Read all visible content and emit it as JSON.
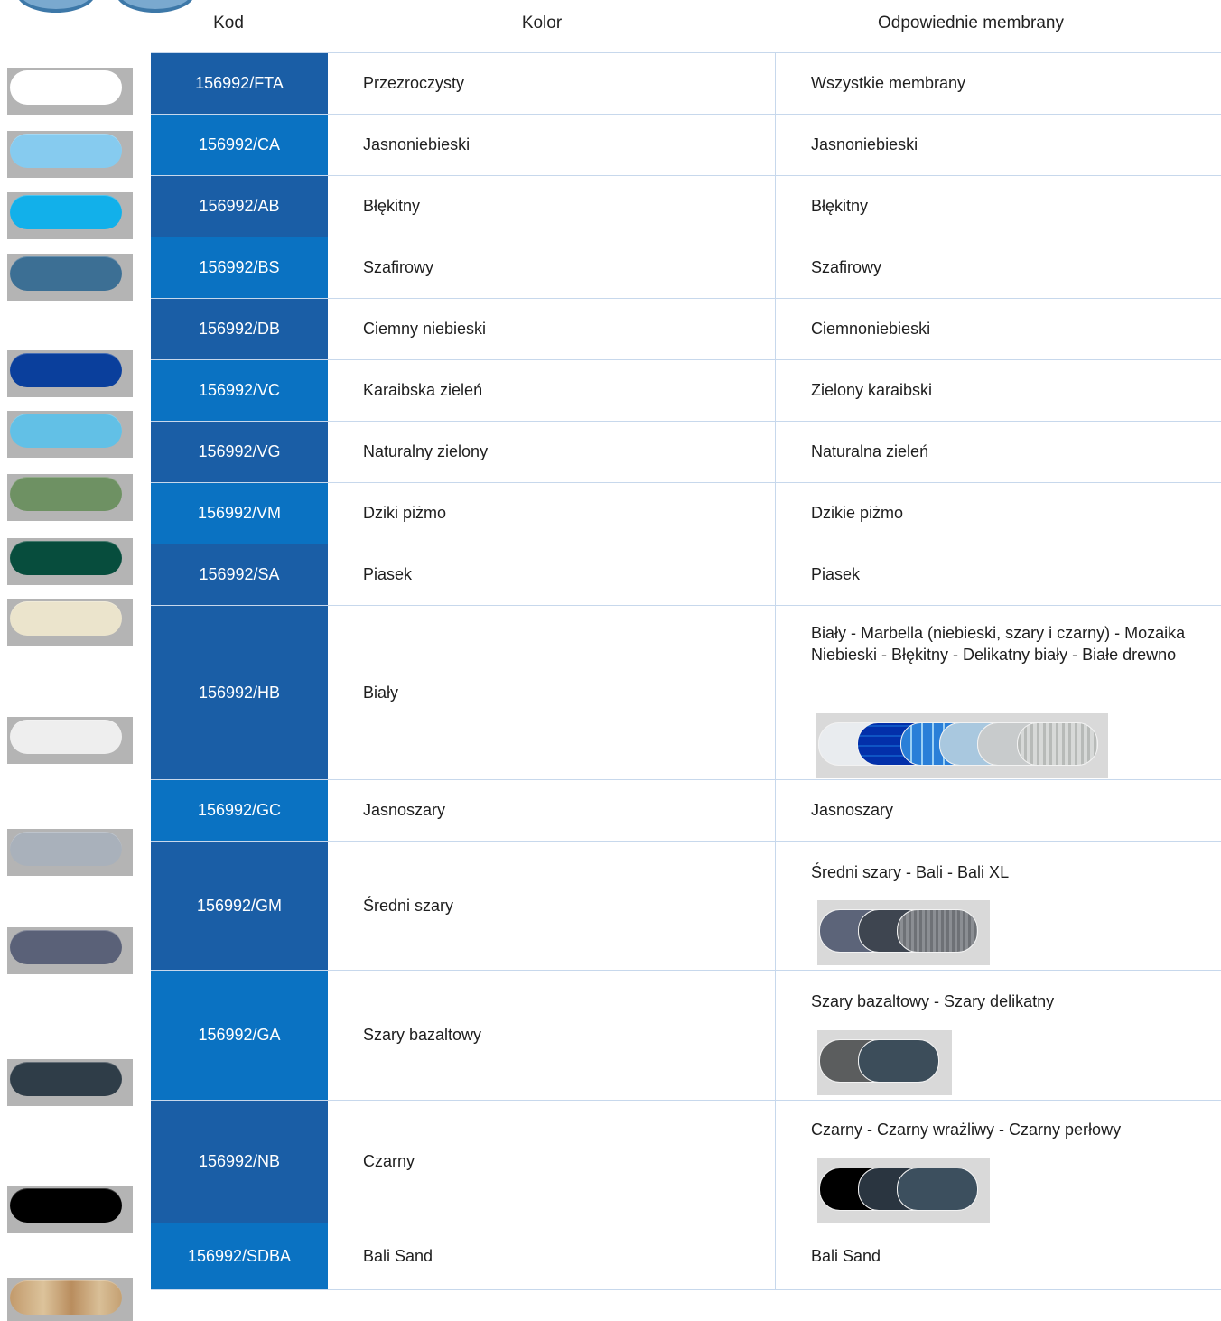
{
  "headers": {
    "code": "Kod",
    "color": "Kolor",
    "membranes": "Odpowiednie membrany"
  },
  "colors": {
    "code_dark": "#1a5ea6",
    "code_light": "#0a72c2",
    "row_line": "#c7d8ec"
  },
  "rows": [
    {
      "code": "156992/FTA",
      "color": "Przezroczysty",
      "membranes": "Wszystkie membrany",
      "swatch": "#ffffff"
    },
    {
      "code": "156992/CA",
      "color": "Jasnoniebieski",
      "membranes": "Jasnoniebieski",
      "swatch": "#86cbef"
    },
    {
      "code": "156992/AB",
      "color": "Błękitny",
      "membranes": "Błękitny",
      "swatch": "#12b0ea"
    },
    {
      "code": "156992/BS",
      "color": "Szafirowy",
      "membranes": "Szafirowy",
      "swatch": "#3c6f94"
    },
    {
      "code": "156992/DB",
      "color": "Ciemny niebieski",
      "membranes": "Ciemnoniebieski",
      "swatch": "#0a3f9c"
    },
    {
      "code": "156992/VC",
      "color": "Karaibska zieleń",
      "membranes": "Zielony karaibski",
      "swatch": "#62c0e6"
    },
    {
      "code": "156992/VG",
      "color": "Naturalny zielony",
      "membranes": "Naturalna zieleń",
      "swatch": "#6e9163"
    },
    {
      "code": "156992/VM",
      "color": "Dziki piżmo",
      "membranes": "Dzikie piżmo",
      "swatch": "#074d3d"
    },
    {
      "code": "156992/SA",
      "color": "Piasek",
      "membranes": "Piasek",
      "swatch": "#ebe4cc"
    },
    {
      "code": "156992/HB",
      "color": "Biały",
      "membranes": "Biały - Marbella (niebieski, szary i czarny) - Mozaika Niebieski - Błękitny - Delikatny biały - Białe drewno",
      "swatch": "#eeeeee"
    },
    {
      "code": "156992/GC",
      "color": "Jasnoszary",
      "membranes": "Jasnoszary",
      "swatch": "#a9b1bb"
    },
    {
      "code": "156992/GM",
      "color": "Średni szary",
      "membranes": "Średni szary - Bali - Bali XL",
      "swatch": "#5a6178"
    },
    {
      "code": "156992/GA",
      "color": "Szary bazaltowy",
      "membranes": "Szary bazaltowy - Szary delikatny",
      "swatch": "#2f3d48"
    },
    {
      "code": "156992/NB",
      "color": "Czarny",
      "membranes": "Czarny - Czarny wrażliwy - Czarny perłowy",
      "swatch": "#000000"
    },
    {
      "code": "156992/SDBA",
      "color": "Bali Sand",
      "membranes": "Bali Sand",
      "swatch": "#c8a67a"
    }
  ],
  "thumbnails": {
    "hb": [
      "#e9ecef",
      "#1a6fd0",
      "#2a7fd8",
      "#a9c8df",
      "#c8cbcc",
      "#b7bab8"
    ],
    "gm": [
      "#5c6479",
      "#3e4550",
      "#6e7176"
    ],
    "ga": [
      "#5b5d5e",
      "#3c4d5a"
    ],
    "nb": [
      "#000000",
      "#2a3540",
      "#3c4f5e"
    ]
  }
}
